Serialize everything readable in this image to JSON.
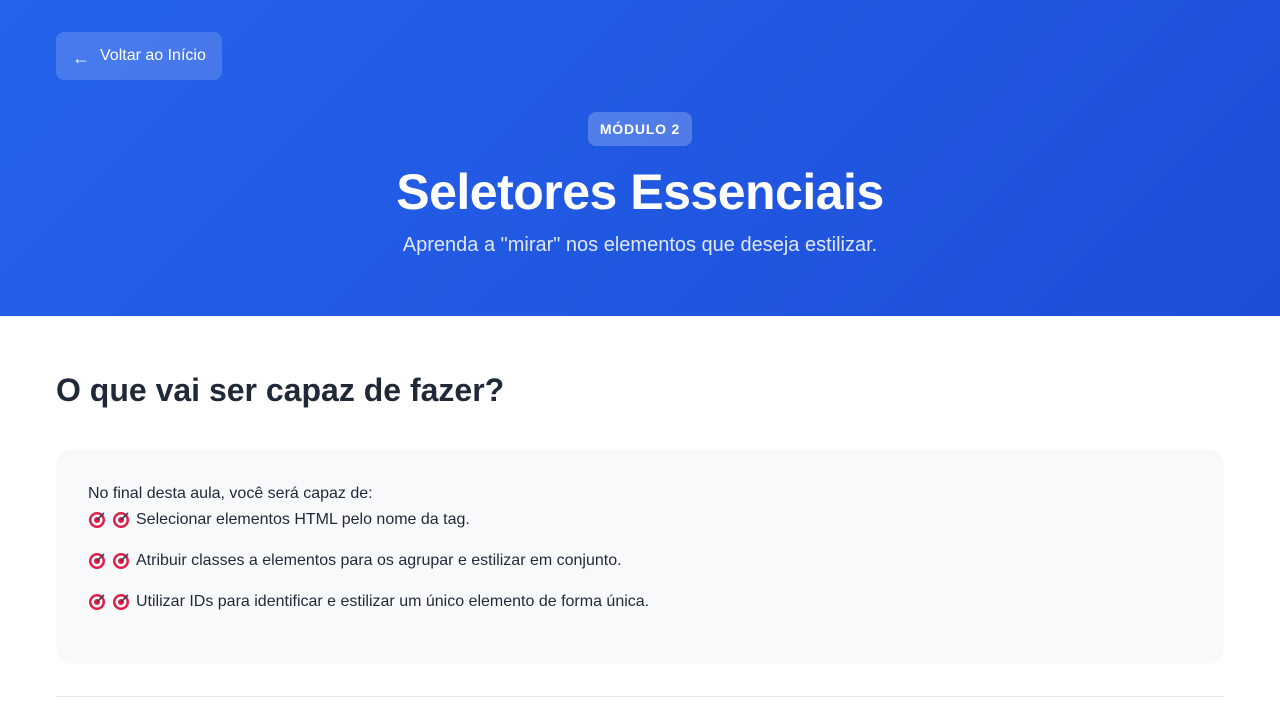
{
  "header": {
    "back_label": "Voltar ao Início",
    "back_icon": "arrow-left-icon",
    "badge": "MÓDULO 2",
    "title": "Seletores Essenciais",
    "subtitle": "Aprenda a \"mirar\" nos elementos que deseja estilizar."
  },
  "main": {
    "section_title": "O que vai ser capaz de fazer?",
    "intro": "No final desta aula, você será capaz de:",
    "objectives": [
      {
        "icon": "target-icon",
        "text": "Selecionar elementos HTML pelo nome da tag."
      },
      {
        "icon": "target-icon",
        "text": "Atribuir classes a elementos para os agrupar e estilizar em conjunto."
      },
      {
        "icon": "target-icon",
        "text": "Utilizar IDs para identificar e estilizar um único elemento de forma única."
      }
    ]
  },
  "colors": {
    "hero_start": "#2563eb",
    "hero_end": "#1d4ed8",
    "card_bg": "#f8f9fa",
    "text_dark": "#1f2937"
  }
}
